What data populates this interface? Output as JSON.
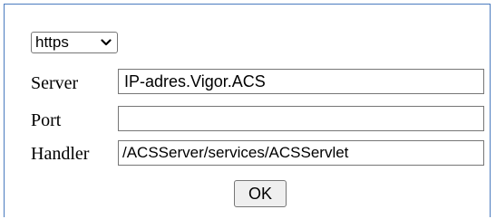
{
  "protocol": {
    "selected": "https"
  },
  "fields": {
    "server": {
      "label": "Server",
      "value": "IP-adres.Vigor.ACS"
    },
    "port": {
      "label": "Port",
      "value": ""
    },
    "handler": {
      "label": "Handler",
      "value": "/ACSServer/services/ACSServlet"
    }
  },
  "ok_label": "OK",
  "colors": {
    "panel_border": "#4a7bbf",
    "control_border": "#767676",
    "button_bg": "#efefef"
  },
  "icons": {
    "select_arrow": "chevron-down-icon"
  }
}
